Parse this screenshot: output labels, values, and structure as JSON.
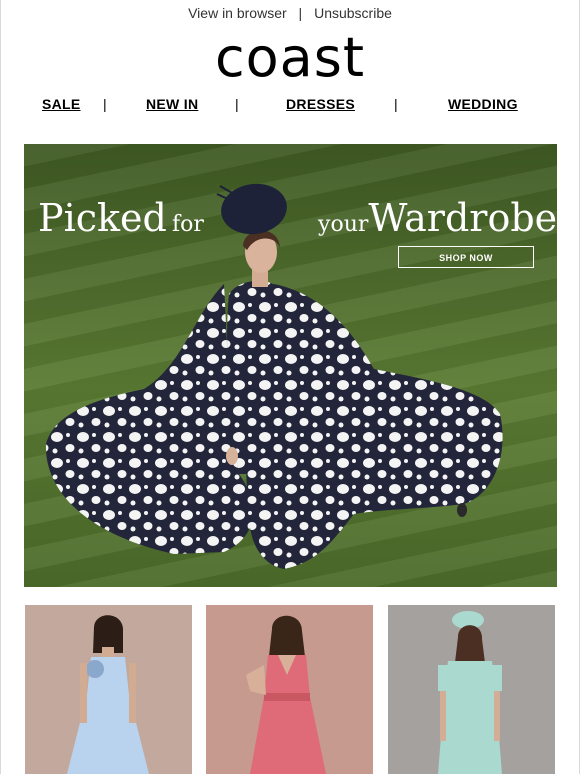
{
  "preheader": {
    "view_in_browser": "View in browser",
    "separator": "|",
    "unsubscribe": "Unsubscribe"
  },
  "logo": {
    "text": "coast"
  },
  "nav": {
    "items": [
      "SALE",
      "NEW IN",
      "DRESSES",
      "WEDDING"
    ],
    "separator": "|"
  },
  "hero": {
    "headline": [
      "Picked",
      "for",
      "your",
      "Wardrobe"
    ],
    "cta": "SHOP NOW",
    "dress_pattern": "navy with white polka dots"
  },
  "products": [
    {
      "dress_color": "#b9d3ee",
      "background": "#c2a89d"
    },
    {
      "dress_color": "#e06b78",
      "background": "#c79a90"
    },
    {
      "dress_color": "#a9d9cf",
      "background": "#a5a19f"
    }
  ],
  "colors": {
    "accent": "#000000",
    "grass": "#4f6c2c"
  }
}
